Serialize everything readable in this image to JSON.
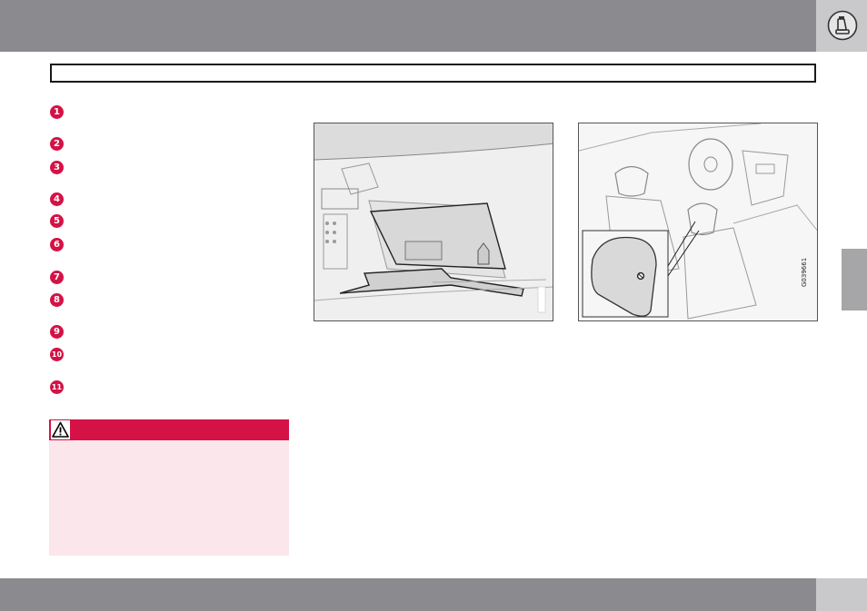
{
  "page": {
    "bullets": [
      "1",
      "2",
      "3",
      "4",
      "5",
      "6",
      "7",
      "8",
      "9",
      "10",
      "11"
    ]
  },
  "figures": [
    {
      "name": "glovebox-illustration",
      "code": ""
    },
    {
      "name": "headrest-illustration",
      "code": "G039661"
    }
  ],
  "colors": {
    "header_gray": "#8b8b8f",
    "corner_gray": "#c9c9cb",
    "accent_red": "#d41245",
    "warning_bg": "#fbe6ec"
  },
  "icons": [
    "seat-icon",
    "warning-triangle-icon"
  ]
}
